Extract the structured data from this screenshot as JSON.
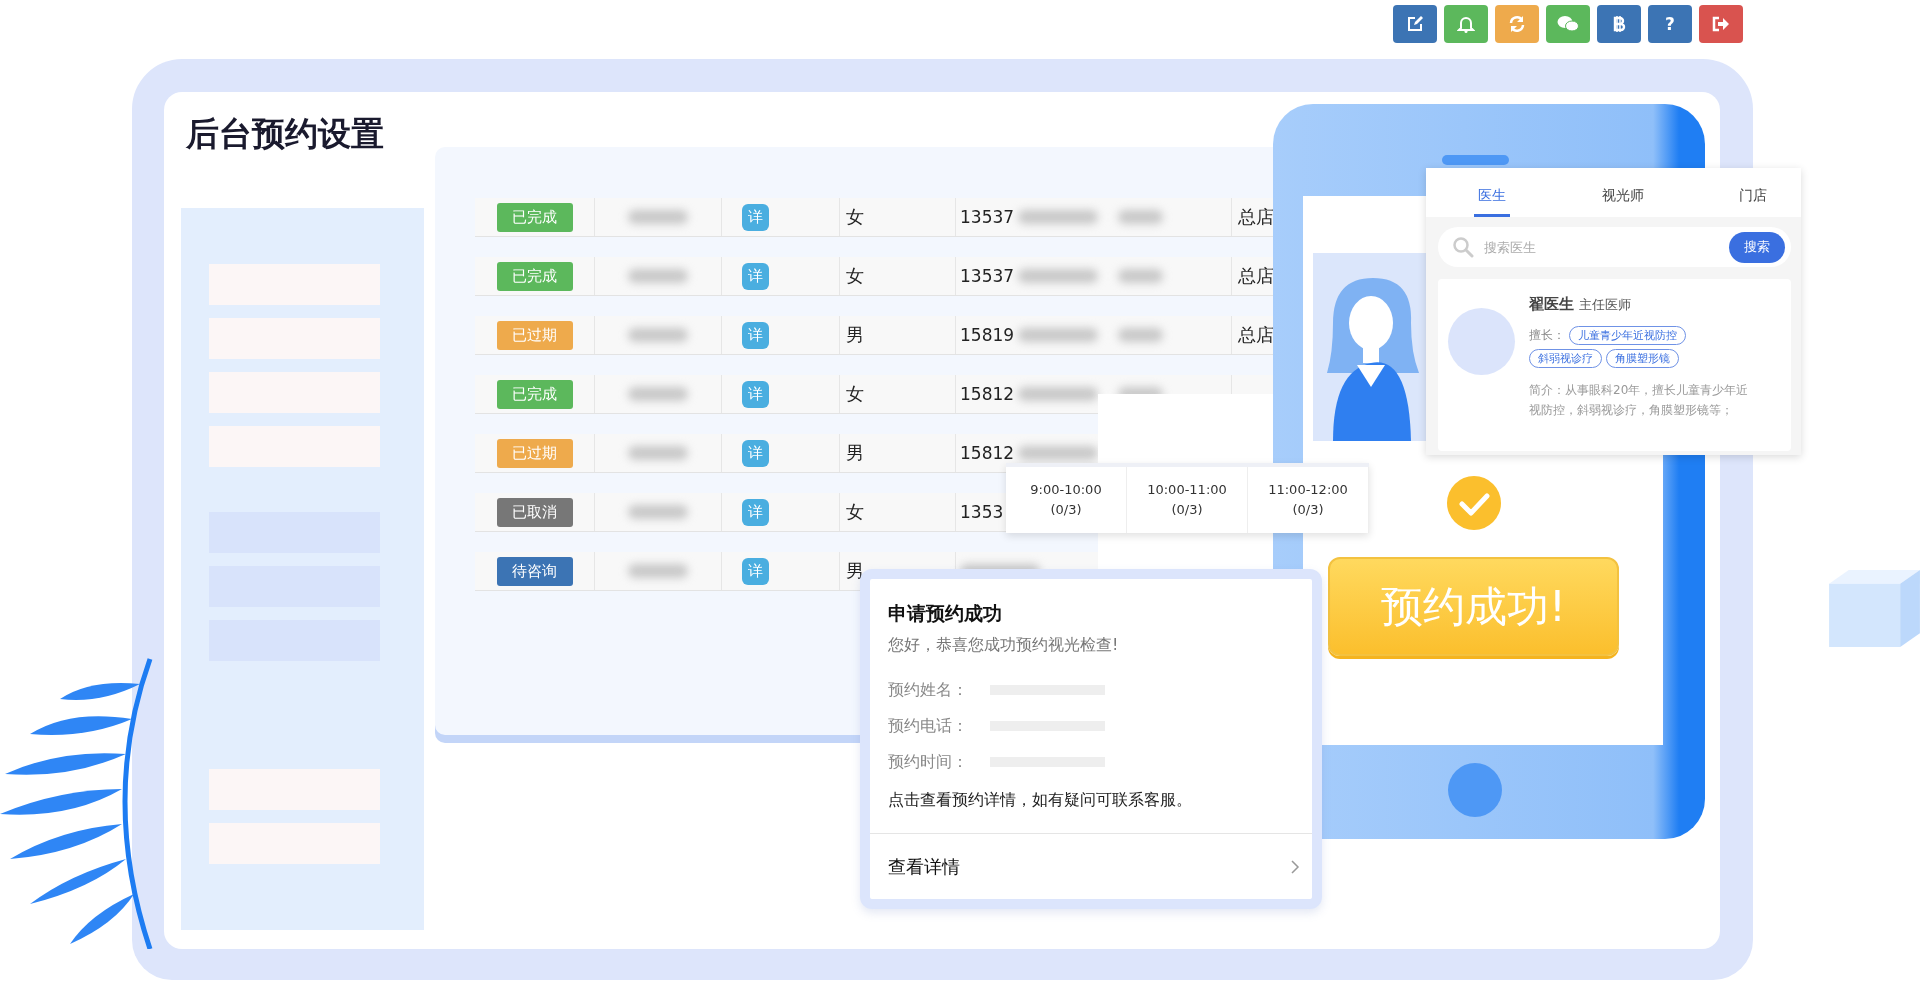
{
  "toolbar": [
    {
      "color": "#3c74b4"
    },
    {
      "color": "#5cb85c"
    },
    {
      "color": "#eeaa4c"
    },
    {
      "color": "#5cb85c"
    },
    {
      "color": "#3c74b4"
    },
    {
      "color": "#3c74b4",
      "label": "?"
    },
    {
      "color": "#d9534f"
    }
  ],
  "title": "后台预约设置",
  "table": {
    "rows": [
      {
        "status": "已完成",
        "color": "#5cb85c",
        "detail": "详",
        "gender": "女",
        "phone": "13537",
        "store": "总店"
      },
      {
        "status": "已完成",
        "color": "#5cb85c",
        "detail": "详",
        "gender": "女",
        "phone": "13537",
        "store": "总店"
      },
      {
        "status": "已过期",
        "color": "#eeaa4c",
        "detail": "详",
        "gender": "男",
        "phone": "15819",
        "store": "总店"
      },
      {
        "status": "已完成",
        "color": "#5cb85c",
        "detail": "详",
        "gender": "女",
        "phone": "15812"
      },
      {
        "status": "已过期",
        "color": "#eeaa4c",
        "detail": "详",
        "gender": "男",
        "phone": "15812"
      },
      {
        "status": "已取消",
        "color": "#777777",
        "detail": "详",
        "gender": "女",
        "phone": "1353"
      },
      {
        "status": "待咨询",
        "color": "#3c74b4",
        "detail": "详",
        "gender": "男"
      }
    ]
  },
  "time_slots": [
    {
      "time": "9:00-10:00",
      "count": "(0/3)"
    },
    {
      "time": "10:00-11:00",
      "count": "(0/3)"
    },
    {
      "time": "11:00-12:00",
      "count": "(0/3)"
    }
  ],
  "success_button": "预约成功!",
  "doctor_panel": {
    "tabs": [
      {
        "label": "医生",
        "selected": true
      },
      {
        "label": "视光师",
        "selected": false
      },
      {
        "label": "门店",
        "selected": false
      }
    ],
    "search": {
      "placeholder": "搜索医生",
      "button": "搜索"
    },
    "doctor": {
      "name": "翟医生",
      "title": "主任医师",
      "specialty_label": "擅长：",
      "tags": [
        "儿童青少年近视防控",
        "斜弱视诊疗",
        "角膜塑形镜"
      ],
      "intro": "简介：从事眼科20年，擅长儿童青少年近视防控，斜弱视诊疗，角膜塑形镜等；"
    }
  },
  "message": {
    "title": "申请预约成功",
    "greeting": "您好，恭喜您成功预约视光检查!",
    "fields": [
      "预约姓名：",
      "预约电话：",
      "预约时间："
    ],
    "note": "点击查看预约详情，如有疑问可联系客服。",
    "link": "查看详情"
  }
}
